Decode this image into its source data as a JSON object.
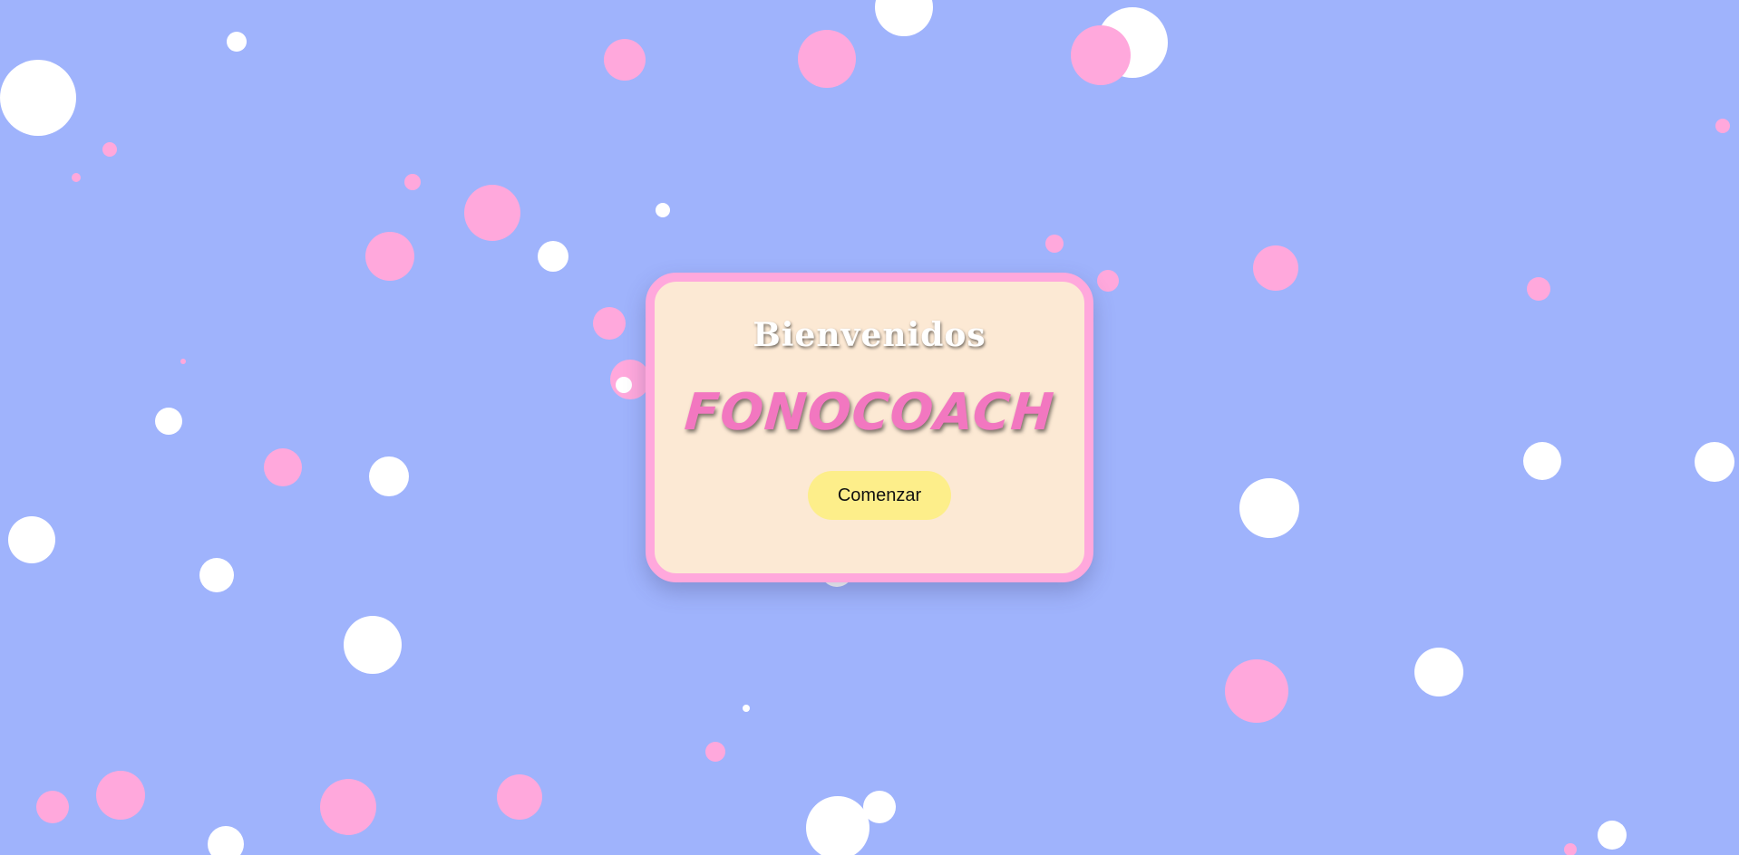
{
  "welcome": {
    "greeting": "Bienvenidos",
    "brand": "FONOCOACH",
    "start_label": "Comenzar"
  },
  "colors": {
    "background": "#9fb3fc",
    "bubble_white": "#ffffff",
    "bubble_pink": "#ffa8dc",
    "card_fill": "#fce9d4",
    "card_border": "#ffa8dc",
    "brand_text": "#f277c0",
    "button_fill": "#fdee8a"
  }
}
